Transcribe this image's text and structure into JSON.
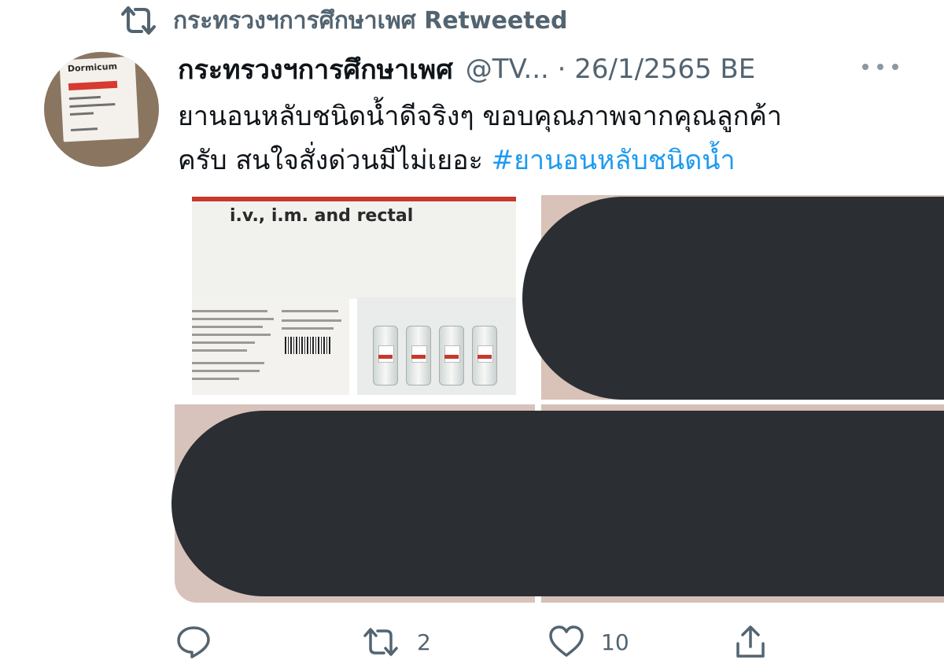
{
  "retweet_banner": {
    "text": "กระทรวงฯการศึกษาเพศ Retweeted"
  },
  "tweet": {
    "display_name": "กระทรวงฯการศึกษาเพศ",
    "handle_date": "@TV... · 26/1/2565 BE",
    "text_line1": "ยานอนหลับชนิดน้ำดีจริงๆ ขอบคุณภาพจากคุณลูกค้า",
    "text_line2_prefix": "ครับ สนใจสั่งด่วนมีไม่เยอะ ",
    "hashtag": "#ยานอนหลับชนิดน้ำ"
  },
  "avatar": {
    "brand_text": "Dormicum"
  },
  "media": {
    "photo1_label": "i.v., i.m. and rectal"
  },
  "actions": {
    "retweet_count": "2",
    "like_count": "10"
  },
  "colors": {
    "text_primary": "#0f1419",
    "text_secondary": "#536471",
    "link": "#1d9bf0",
    "redaction": "#2b2f33"
  },
  "icons": [
    "retweet-icon",
    "more-icon",
    "reply-icon",
    "like-icon",
    "share-icon"
  ]
}
